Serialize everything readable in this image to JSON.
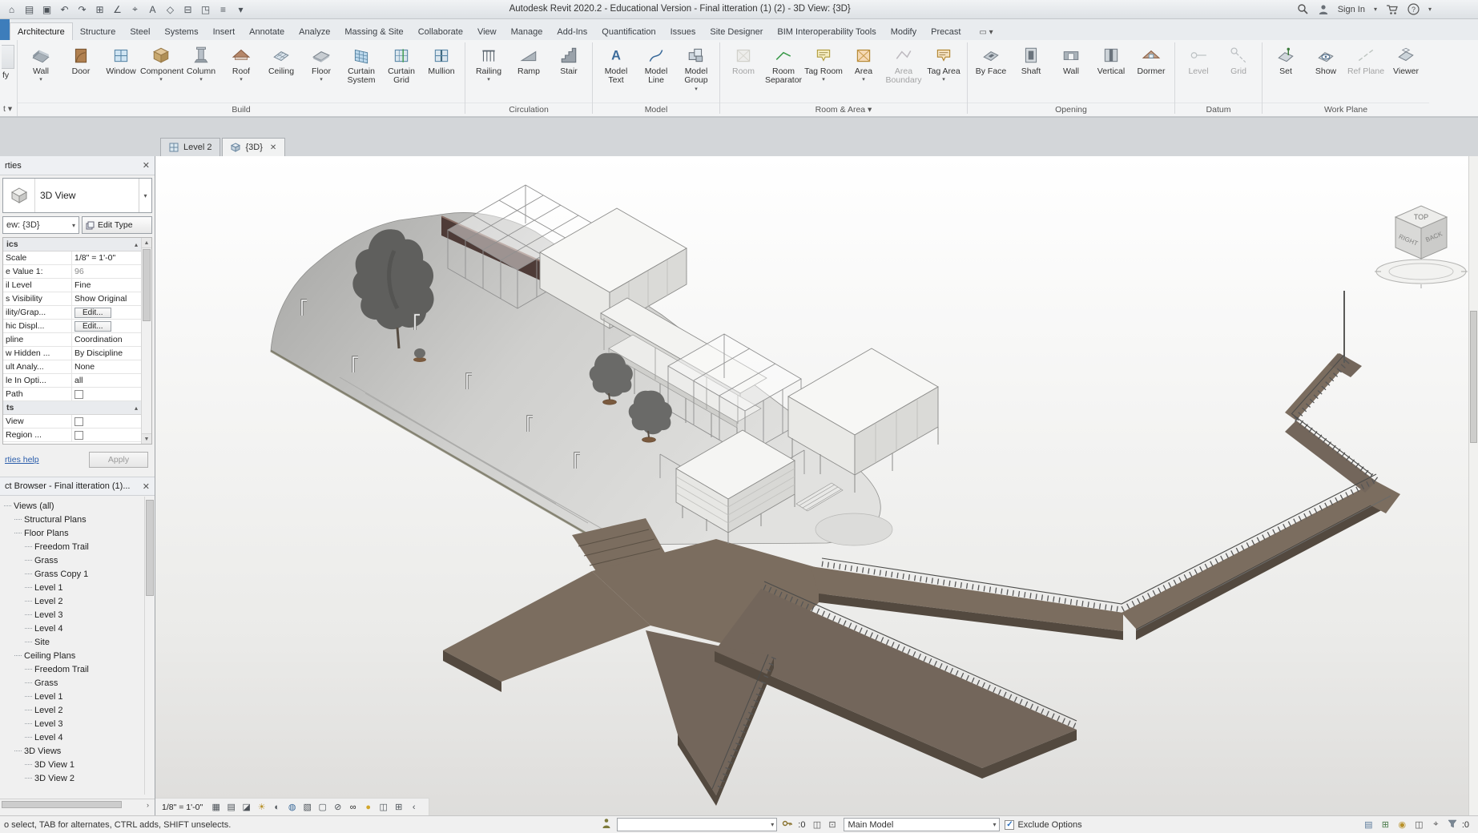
{
  "colors": {
    "path-brown": "#7b6d5f",
    "path-brown-dark": "#73665b",
    "path-side": "#53493f",
    "wall-maroon": "#4e3b37",
    "model-white": "#f6f6f4",
    "accent-blue": "#3d7dbb"
  },
  "title_bar": {
    "title": "Autodesk Revit 2020.2 - Educational Version - Final itteration (1) (2) - 3D View: {3D}",
    "sign_in_label": "Sign In",
    "quick_access_icons": [
      {
        "name": "app-home-icon",
        "glyph": "⌂"
      },
      {
        "name": "open-icon",
        "glyph": "▤"
      },
      {
        "name": "save-icon",
        "glyph": "▣"
      },
      {
        "name": "undo-icon",
        "glyph": "↶"
      },
      {
        "name": "redo-icon",
        "glyph": "↷"
      },
      {
        "name": "print-icon",
        "glyph": "⊞"
      },
      {
        "name": "measure-icon",
        "glyph": "∠"
      },
      {
        "name": "aligned-dimension-icon",
        "glyph": "⌖"
      },
      {
        "name": "text-icon",
        "glyph": "A"
      },
      {
        "name": "tag-icon",
        "glyph": "◇"
      },
      {
        "name": "section-icon",
        "glyph": "⊟"
      },
      {
        "name": "default-3d-view-icon",
        "glyph": "◳"
      },
      {
        "name": "thin-lines-icon",
        "glyph": "≡"
      },
      {
        "name": "qat-dropdown-icon",
        "glyph": "▾"
      }
    ]
  },
  "ribbon_tabs": [
    {
      "label": "Architecture",
      "active": true
    },
    {
      "label": "Structure"
    },
    {
      "label": "Steel"
    },
    {
      "label": "Systems"
    },
    {
      "label": "Insert"
    },
    {
      "label": "Annotate"
    },
    {
      "label": "Analyze"
    },
    {
      "label": "Massing & Site"
    },
    {
      "label": "Collaborate"
    },
    {
      "label": "View"
    },
    {
      "label": "Manage"
    },
    {
      "label": "Add-Ins"
    },
    {
      "label": "Quantification"
    },
    {
      "label": "Issues"
    },
    {
      "label": "Site Designer"
    },
    {
      "label": "BIM Interoperability Tools"
    },
    {
      "label": "Modify"
    },
    {
      "label": "Precast"
    }
  ],
  "select_panel": {
    "modify_cropped": "fy",
    "select_cropped": "t ▾"
  },
  "ribbon": {
    "panels": [
      {
        "label": "Build",
        "tools": [
          {
            "label": "Wall",
            "icon": "wall",
            "dropdown": true
          },
          {
            "label": "Door",
            "icon": "door"
          },
          {
            "label": "Window",
            "icon": "window"
          },
          {
            "label": "Component",
            "icon": "component",
            "dropdown": true
          },
          {
            "label": "Column",
            "icon": "column",
            "dropdown": true
          },
          {
            "label": "Roof",
            "icon": "roof",
            "dropdown": true
          },
          {
            "label": "Ceiling",
            "icon": "ceiling"
          },
          {
            "label": "Floor",
            "icon": "floor",
            "dropdown": true
          },
          {
            "label": "Curtain System",
            "icon": "curtain-system"
          },
          {
            "label": "Curtain Grid",
            "icon": "curtain-grid"
          },
          {
            "label": "Mullion",
            "icon": "mullion"
          }
        ]
      },
      {
        "label": "Circulation",
        "tools": [
          {
            "label": "Railing",
            "icon": "railing",
            "dropdown": true
          },
          {
            "label": "Ramp",
            "icon": "ramp"
          },
          {
            "label": "Stair",
            "icon": "stair"
          }
        ]
      },
      {
        "label": "Model",
        "tools": [
          {
            "label": "Model Text",
            "icon": "model-text"
          },
          {
            "label": "Model Line",
            "icon": "model-line"
          },
          {
            "label": "Model Group",
            "icon": "model-group",
            "dropdown": true
          }
        ]
      },
      {
        "label": "Room & Area",
        "dropdown": true,
        "tools": [
          {
            "label": "Room",
            "icon": "room",
            "disabled": true
          },
          {
            "label": "Room Separator",
            "icon": "room-separator"
          },
          {
            "label": "Tag Room",
            "icon": "tag-room",
            "dropdown": true
          },
          {
            "label": "Area",
            "icon": "area",
            "dropdown": true
          },
          {
            "label": "Area Boundary",
            "icon": "area-boundary",
            "disabled": true
          },
          {
            "label": "Tag Area",
            "icon": "tag-area",
            "dropdown": true
          }
        ]
      },
      {
        "label": "Opening",
        "tools": [
          {
            "label": "By Face",
            "icon": "by-face"
          },
          {
            "label": "Shaft",
            "icon": "shaft"
          },
          {
            "label": "Wall",
            "icon": "wall-opening"
          },
          {
            "label": "Vertical",
            "icon": "vertical"
          },
          {
            "label": "Dormer",
            "icon": "dormer"
          }
        ]
      },
      {
        "label": "Datum",
        "tools": [
          {
            "label": "Level",
            "icon": "level",
            "disabled": true
          },
          {
            "label": "Grid",
            "icon": "grid",
            "disabled": true
          }
        ]
      },
      {
        "label": "Work Plane",
        "tools": [
          {
            "label": "Set",
            "icon": "set"
          },
          {
            "label": "Show",
            "icon": "show"
          },
          {
            "label": "Ref Plane",
            "icon": "ref-plane",
            "disabled": true
          },
          {
            "label": "Viewer",
            "icon": "viewer"
          }
        ]
      }
    ]
  },
  "view_tabs": [
    {
      "label": "Level 2",
      "icon": "plan"
    },
    {
      "label": "{3D}",
      "icon": "3d",
      "active": true,
      "closable": true
    }
  ],
  "properties": {
    "header": "rties",
    "type_selector_label": "3D View",
    "view_combo": "ew: {3D}",
    "edit_type_label": "Edit Type",
    "sections": [
      {
        "label": "ics",
        "rows": [
          {
            "label": "Scale",
            "value": "1/8\" = 1'-0\""
          },
          {
            "label": "e Value    1:",
            "value": "96",
            "muted": true
          },
          {
            "label": "il Level",
            "value": "Fine"
          },
          {
            "label": "s Visibility",
            "value": "Show Original"
          },
          {
            "label": "ility/Grap...",
            "value": "Edit...",
            "button": true
          },
          {
            "label": "hic Displ...",
            "value": "Edit...",
            "button": true
          },
          {
            "label": "pline",
            "value": "Coordination"
          },
          {
            "label": "w Hidden ...",
            "value": "By Discipline"
          },
          {
            "label": "ult Analy...",
            "value": "None"
          },
          {
            "label": "le In Opti...",
            "value": "all"
          },
          {
            "label": "Path",
            "checkbox": true
          }
        ]
      },
      {
        "label": "ts",
        "rows": [
          {
            "label": "View",
            "checkbox": true
          },
          {
            "label": "Region ...",
            "checkbox": true
          }
        ]
      }
    ],
    "help_link": "rties help",
    "apply_label": "Apply"
  },
  "project_browser": {
    "header": "ct Browser - Final itteration (1)...",
    "tree": [
      {
        "label": "Views (all)",
        "depth": 0
      },
      {
        "label": "Structural Plans",
        "depth": 1
      },
      {
        "label": "Floor Plans",
        "depth": 1
      },
      {
        "label": "Freedom Trail",
        "depth": 2
      },
      {
        "label": "Grass",
        "depth": 2
      },
      {
        "label": "Grass Copy 1",
        "depth": 2
      },
      {
        "label": "Level 1",
        "depth": 2
      },
      {
        "label": "Level 2",
        "depth": 2
      },
      {
        "label": "Level 3",
        "depth": 2
      },
      {
        "label": "Level 4",
        "depth": 2
      },
      {
        "label": "Site",
        "depth": 2
      },
      {
        "label": "Ceiling Plans",
        "depth": 1
      },
      {
        "label": "Freedom Trail",
        "depth": 2
      },
      {
        "label": "Grass",
        "depth": 2
      },
      {
        "label": "Level 1",
        "depth": 2
      },
      {
        "label": "Level 2",
        "depth": 2
      },
      {
        "label": "Level 3",
        "depth": 2
      },
      {
        "label": "Level 4",
        "depth": 2
      },
      {
        "label": "3D Views",
        "depth": 1
      },
      {
        "label": "3D View 1",
        "depth": 2
      },
      {
        "label": "3D View 2",
        "depth": 2
      }
    ]
  },
  "view_controls": {
    "scale": "1/8\" = 1'-0\"",
    "icons": [
      {
        "name": "model-display-icon",
        "glyph": "▦"
      },
      {
        "name": "detail-level-icon",
        "glyph": "▤"
      },
      {
        "name": "visual-style-icon",
        "glyph": "◪"
      },
      {
        "name": "sun-path-icon",
        "glyph": "☀",
        "color": "#b8912a"
      },
      {
        "name": "shadows-icon",
        "glyph": "◐"
      },
      {
        "name": "rendering-dialog-icon",
        "glyph": "◍",
        "color": "#3a6a9a"
      },
      {
        "name": "crop-view-icon",
        "glyph": "▧"
      },
      {
        "name": "show-crop-icon",
        "glyph": "▢"
      },
      {
        "name": "unlock-view-icon",
        "glyph": "⊘"
      },
      {
        "name": "temporary-hide-isolate-icon",
        "glyph": "∞",
        "color": "#222222"
      },
      {
        "name": "reveal-hidden-icon",
        "glyph": "●",
        "color": "#d2a62a"
      },
      {
        "name": "temporary-view-properties-icon",
        "glyph": "◫"
      },
      {
        "name": "show-constraints-icon",
        "glyph": "⊞"
      },
      {
        "name": "collapse-view-bar-icon",
        "glyph": "‹"
      }
    ]
  },
  "status_bar": {
    "message": "o select, TAB for alternates, CTRL adds, SHIFT unselects.",
    "counter_mid": ":0",
    "counter_right": ":0",
    "mid_icons": [
      {
        "name": "editing-requests-icon",
        "glyph": "◫"
      },
      {
        "name": "design-options-icon",
        "glyph": "⊡"
      }
    ],
    "design_option_label": "Main Model",
    "exclude_options_label": "Exclude Options",
    "exclude_checked": true,
    "right_icons": [
      {
        "name": "worksharing-display-icon",
        "glyph": "▤",
        "color": "#5a7a9a"
      },
      {
        "name": "reveal-constraints-icon",
        "glyph": "⊞",
        "color": "#4a7a4a"
      },
      {
        "name": "reveal-hidden-elements-icon",
        "glyph": "◉",
        "color": "#b8912a"
      },
      {
        "name": "temporary-view-icon",
        "glyph": "◫",
        "color": "#555555"
      },
      {
        "name": "select-toggles-icon",
        "glyph": "⌖",
        "color": "#555555"
      }
    ]
  },
  "viewcube": {
    "top": "TOP",
    "left": "RIGHT",
    "right": "BACK"
  }
}
